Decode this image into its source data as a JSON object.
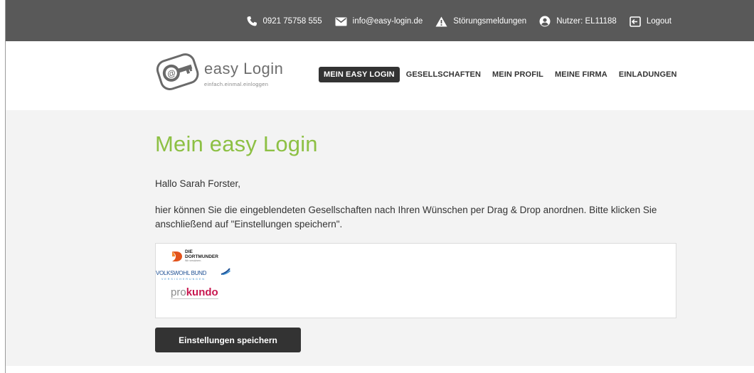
{
  "topbar": {
    "phone": "0921 75758 555",
    "email": "info@easy-login.de",
    "status_label": "Störungsmeldungen",
    "user_label": "Nutzer: EL11188",
    "logout_label": "Logout",
    "icons": [
      "phone-icon",
      "mail-icon",
      "warning-icon",
      "user-icon",
      "logout-icon"
    ]
  },
  "logo": {
    "title": "easy Login",
    "tagline": "einfach.einmal.einloggen"
  },
  "nav": {
    "items": [
      {
        "label": "MEIN EASY LOGIN",
        "active": true
      },
      {
        "label": "GESELLSCHAFTEN",
        "active": false
      },
      {
        "label": "MEIN PROFIL",
        "active": false
      },
      {
        "label": "MEINE FIRMA",
        "active": false
      },
      {
        "label": "EINLADUNGEN",
        "active": false
      }
    ]
  },
  "main": {
    "title": "Mein easy Login",
    "greeting": "Hallo Sarah Forster,",
    "intro": "hier können Sie die eingeblendeten Gesellschaften nach Ihren Wünschen per Drag & Drop anordnen. Bitte klicken Sie anschließend auf \"Einstellungen speichern\".",
    "companies": [
      {
        "line1": "DIE",
        "line2": "DORTMUNDER",
        "line3": "Wir versichern."
      },
      {
        "name": "VOLKSWOHL BUND",
        "sub": "VERSICHERUNGEN"
      },
      {
        "part1": "pro",
        "part2": "kundo"
      }
    ],
    "save_label": "Einstellungen speichern"
  },
  "colors": {
    "topbar_bg": "#595959",
    "accent_green": "#8dc044",
    "button_dark": "#333333",
    "main_bg": "#f3f3f3"
  }
}
